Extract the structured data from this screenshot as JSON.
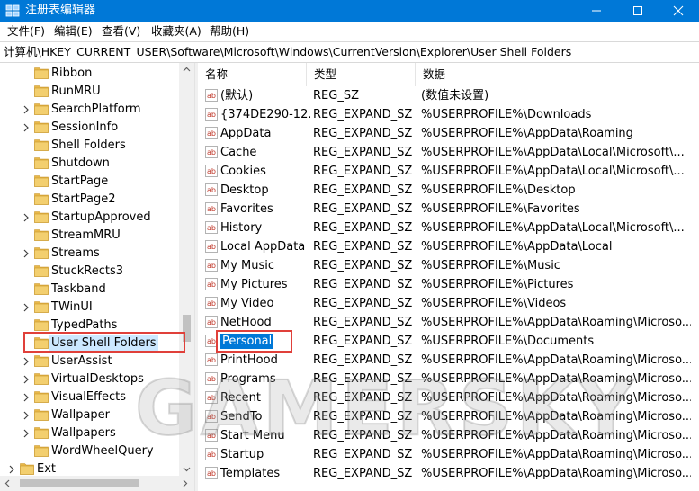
{
  "window": {
    "title": "注册表编辑器",
    "controls": [
      "minimize-icon",
      "maximize-icon",
      "close-icon"
    ]
  },
  "menu": [
    "文件(F)",
    "编辑(E)",
    "查看(V)",
    "收藏夹(A)",
    "帮助(H)"
  ],
  "address": "计算机\\HKEY_CURRENT_USER\\Software\\Microsoft\\Windows\\CurrentVersion\\Explorer\\User Shell Folders",
  "tree": {
    "items": [
      {
        "label": "Ribbon",
        "expandable": false
      },
      {
        "label": "RunMRU",
        "expandable": false
      },
      {
        "label": "SearchPlatform",
        "expandable": true
      },
      {
        "label": "SessionInfo",
        "expandable": true
      },
      {
        "label": "Shell Folders",
        "expandable": false
      },
      {
        "label": "Shutdown",
        "expandable": false
      },
      {
        "label": "StartPage",
        "expandable": false
      },
      {
        "label": "StartPage2",
        "expandable": false
      },
      {
        "label": "StartupApproved",
        "expandable": true
      },
      {
        "label": "StreamMRU",
        "expandable": false
      },
      {
        "label": "Streams",
        "expandable": true
      },
      {
        "label": "StuckRects3",
        "expandable": false
      },
      {
        "label": "Taskband",
        "expandable": false
      },
      {
        "label": "TWinUI",
        "expandable": true
      },
      {
        "label": "TypedPaths",
        "expandable": false
      },
      {
        "label": "User Shell Folders",
        "expandable": false,
        "selected": true
      },
      {
        "label": "UserAssist",
        "expandable": true
      },
      {
        "label": "VirtualDesktops",
        "expandable": true
      },
      {
        "label": "VisualEffects",
        "expandable": true
      },
      {
        "label": "Wallpaper",
        "expandable": true
      },
      {
        "label": "Wallpapers",
        "expandable": true
      },
      {
        "label": "WordWheelQuery",
        "expandable": false
      }
    ],
    "parent_item": {
      "label": "Ext",
      "expandable": true
    }
  },
  "list": {
    "headers": {
      "name": "名称",
      "type": "类型",
      "data": "数据"
    },
    "rows": [
      {
        "name": "(默认)",
        "type": "REG_SZ",
        "data": "(数值未设置)"
      },
      {
        "name": "{374DE290-12...",
        "type": "REG_EXPAND_SZ",
        "data": "%USERPROFILE%\\Downloads"
      },
      {
        "name": "AppData",
        "type": "REG_EXPAND_SZ",
        "data": "%USERPROFILE%\\AppData\\Roaming"
      },
      {
        "name": "Cache",
        "type": "REG_EXPAND_SZ",
        "data": "%USERPROFILE%\\AppData\\Local\\Microsoft\\..."
      },
      {
        "name": "Cookies",
        "type": "REG_EXPAND_SZ",
        "data": "%USERPROFILE%\\AppData\\Local\\Microsoft\\..."
      },
      {
        "name": "Desktop",
        "type": "REG_EXPAND_SZ",
        "data": "%USERPROFILE%\\Desktop"
      },
      {
        "name": "Favorites",
        "type": "REG_EXPAND_SZ",
        "data": "%USERPROFILE%\\Favorites"
      },
      {
        "name": "History",
        "type": "REG_EXPAND_SZ",
        "data": "%USERPROFILE%\\AppData\\Local\\Microsoft\\..."
      },
      {
        "name": "Local AppData",
        "type": "REG_EXPAND_SZ",
        "data": "%USERPROFILE%\\AppData\\Local"
      },
      {
        "name": "My Music",
        "type": "REG_EXPAND_SZ",
        "data": "%USERPROFILE%\\Music"
      },
      {
        "name": "My Pictures",
        "type": "REG_EXPAND_SZ",
        "data": "%USERPROFILE%\\Pictures"
      },
      {
        "name": "My Video",
        "type": "REG_EXPAND_SZ",
        "data": "%USERPROFILE%\\Videos"
      },
      {
        "name": "NetHood",
        "type": "REG_EXPAND_SZ",
        "data": "%USERPROFILE%\\AppData\\Roaming\\Microso..."
      },
      {
        "name": "Personal",
        "type": "REG_EXPAND_SZ",
        "data": "%USERPROFILE%\\Documents",
        "selected": true
      },
      {
        "name": "PrintHood",
        "type": "REG_EXPAND_SZ",
        "data": "%USERPROFILE%\\AppData\\Roaming\\Microso..."
      },
      {
        "name": "Programs",
        "type": "REG_EXPAND_SZ",
        "data": "%USERPROFILE%\\AppData\\Roaming\\Microso..."
      },
      {
        "name": "Recent",
        "type": "REG_EXPAND_SZ",
        "data": "%USERPROFILE%\\AppData\\Roaming\\Microso..."
      },
      {
        "name": "SendTo",
        "type": "REG_EXPAND_SZ",
        "data": "%USERPROFILE%\\AppData\\Roaming\\Microso..."
      },
      {
        "name": "Start Menu",
        "type": "REG_EXPAND_SZ",
        "data": "%USERPROFILE%\\AppData\\Roaming\\Microso..."
      },
      {
        "name": "Startup",
        "type": "REG_EXPAND_SZ",
        "data": "%USERPROFILE%\\AppData\\Roaming\\Microso..."
      },
      {
        "name": "Templates",
        "type": "REG_EXPAND_SZ",
        "data": "%USERPROFILE%\\AppData\\Roaming\\Microso..."
      }
    ],
    "value_icon_text": "ab"
  },
  "watermark": "GAMERSKY",
  "colors": {
    "titlebar": "#0078d7",
    "selection": "#0078d7",
    "tree_selection": "#cce8ff",
    "highlight_box": "#e0403a",
    "folder": "#e8b84a"
  }
}
